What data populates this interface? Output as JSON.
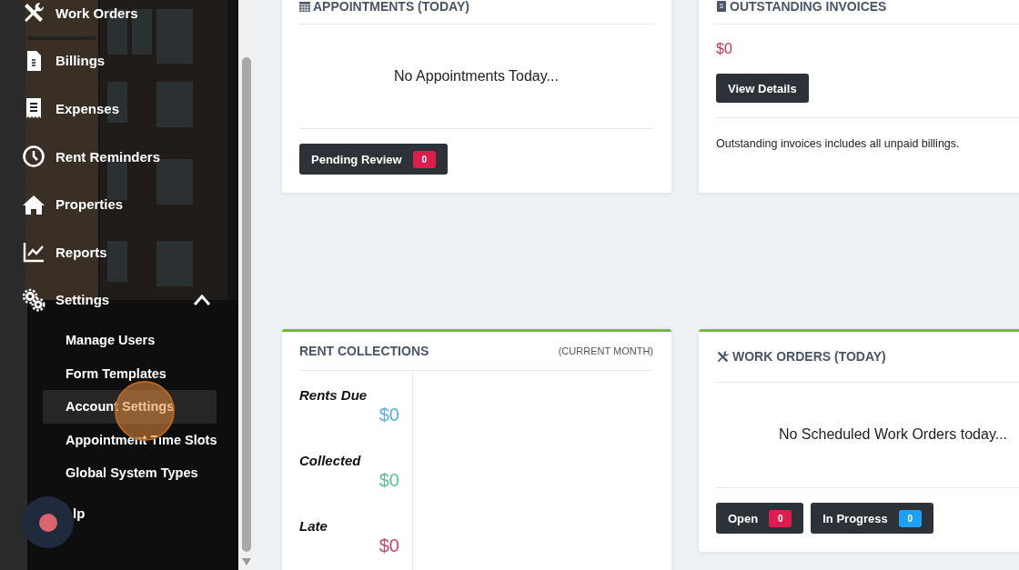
{
  "sidebar": {
    "items": [
      {
        "label": "Work Orders"
      },
      {
        "label": "Billings"
      },
      {
        "label": "Expenses"
      },
      {
        "label": "Rent Reminders"
      },
      {
        "label": "Properties"
      },
      {
        "label": "Reports"
      },
      {
        "label": "Settings",
        "expanded": true,
        "children": [
          {
            "label": "Manage Users",
            "selected": false
          },
          {
            "label": "Form Templates",
            "selected": false
          },
          {
            "label": "Account Settings",
            "selected": true
          },
          {
            "label": "Appointment Time Slots",
            "selected": false
          },
          {
            "label": "Global System Types",
            "selected": false
          }
        ]
      },
      {
        "label": "lp"
      }
    ]
  },
  "appointments": {
    "title": "APPOINTMENTS (TODAY)",
    "empty_text": "No Appointments Today...",
    "buttons": [
      {
        "label": "Pending Review",
        "count": "0",
        "color": "#dc1e4f"
      }
    ]
  },
  "invoices": {
    "title": "OUTSTANDING INVOICES",
    "amount": "$0",
    "button": "View Details",
    "note": "Outstanding invoices includes all unpaid billings."
  },
  "rent_collections": {
    "title": "RENT COLLECTIONS",
    "period": "(CURRENT MONTH)",
    "stats": [
      {
        "label": "Rents Due",
        "amount": "$0",
        "color": "#5aaee0"
      },
      {
        "label": "Collected",
        "amount": "$0",
        "color": "#5fc08f"
      },
      {
        "label": "Late",
        "amount": "$0",
        "color": "#c9476a"
      }
    ]
  },
  "work_orders": {
    "title": "WORK ORDERS (TODAY)",
    "empty_text": "No Scheduled Work Orders today...",
    "buttons": [
      {
        "label": "Open",
        "count": "0",
        "color": "#dc1e4f"
      },
      {
        "label": "In Progress",
        "count": "0",
        "color": "#1ea1f2"
      }
    ]
  }
}
